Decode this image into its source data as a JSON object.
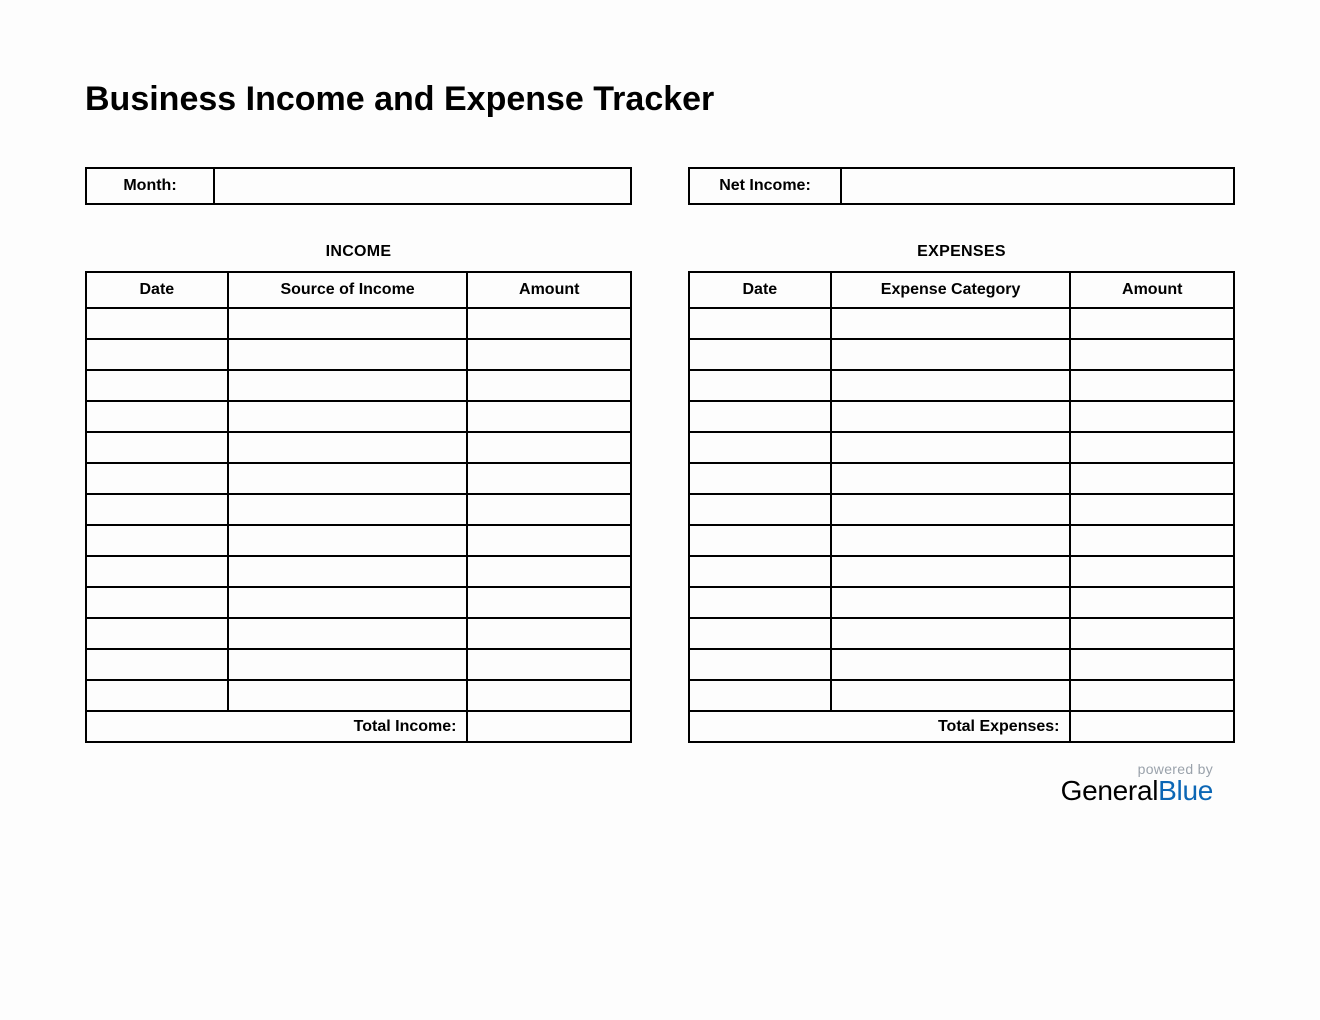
{
  "title": "Business Income and Expense Tracker",
  "summary": {
    "month_label": "Month:",
    "month_value": "",
    "net_income_label": "Net Income:",
    "net_income_value": ""
  },
  "income": {
    "heading": "INCOME",
    "columns": [
      "Date",
      "Source of Income",
      "Amount"
    ],
    "rows": [
      {
        "date": "",
        "desc": "",
        "amount": ""
      },
      {
        "date": "",
        "desc": "",
        "amount": ""
      },
      {
        "date": "",
        "desc": "",
        "amount": ""
      },
      {
        "date": "",
        "desc": "",
        "amount": ""
      },
      {
        "date": "",
        "desc": "",
        "amount": ""
      },
      {
        "date": "",
        "desc": "",
        "amount": ""
      },
      {
        "date": "",
        "desc": "",
        "amount": ""
      },
      {
        "date": "",
        "desc": "",
        "amount": ""
      },
      {
        "date": "",
        "desc": "",
        "amount": ""
      },
      {
        "date": "",
        "desc": "",
        "amount": ""
      },
      {
        "date": "",
        "desc": "",
        "amount": ""
      },
      {
        "date": "",
        "desc": "",
        "amount": ""
      },
      {
        "date": "",
        "desc": "",
        "amount": ""
      }
    ],
    "total_label": "Total Income:",
    "total_value": ""
  },
  "expenses": {
    "heading": "EXPENSES",
    "columns": [
      "Date",
      "Expense Category",
      "Amount"
    ],
    "rows": [
      {
        "date": "",
        "desc": "",
        "amount": ""
      },
      {
        "date": "",
        "desc": "",
        "amount": ""
      },
      {
        "date": "",
        "desc": "",
        "amount": ""
      },
      {
        "date": "",
        "desc": "",
        "amount": ""
      },
      {
        "date": "",
        "desc": "",
        "amount": ""
      },
      {
        "date": "",
        "desc": "",
        "amount": ""
      },
      {
        "date": "",
        "desc": "",
        "amount": ""
      },
      {
        "date": "",
        "desc": "",
        "amount": ""
      },
      {
        "date": "",
        "desc": "",
        "amount": ""
      },
      {
        "date": "",
        "desc": "",
        "amount": ""
      },
      {
        "date": "",
        "desc": "",
        "amount": ""
      },
      {
        "date": "",
        "desc": "",
        "amount": ""
      },
      {
        "date": "",
        "desc": "",
        "amount": ""
      }
    ],
    "total_label": "Total Expenses:",
    "total_value": ""
  },
  "footer": {
    "powered_by": "powered by",
    "brand_part1": "General",
    "brand_part2": "Blue"
  }
}
